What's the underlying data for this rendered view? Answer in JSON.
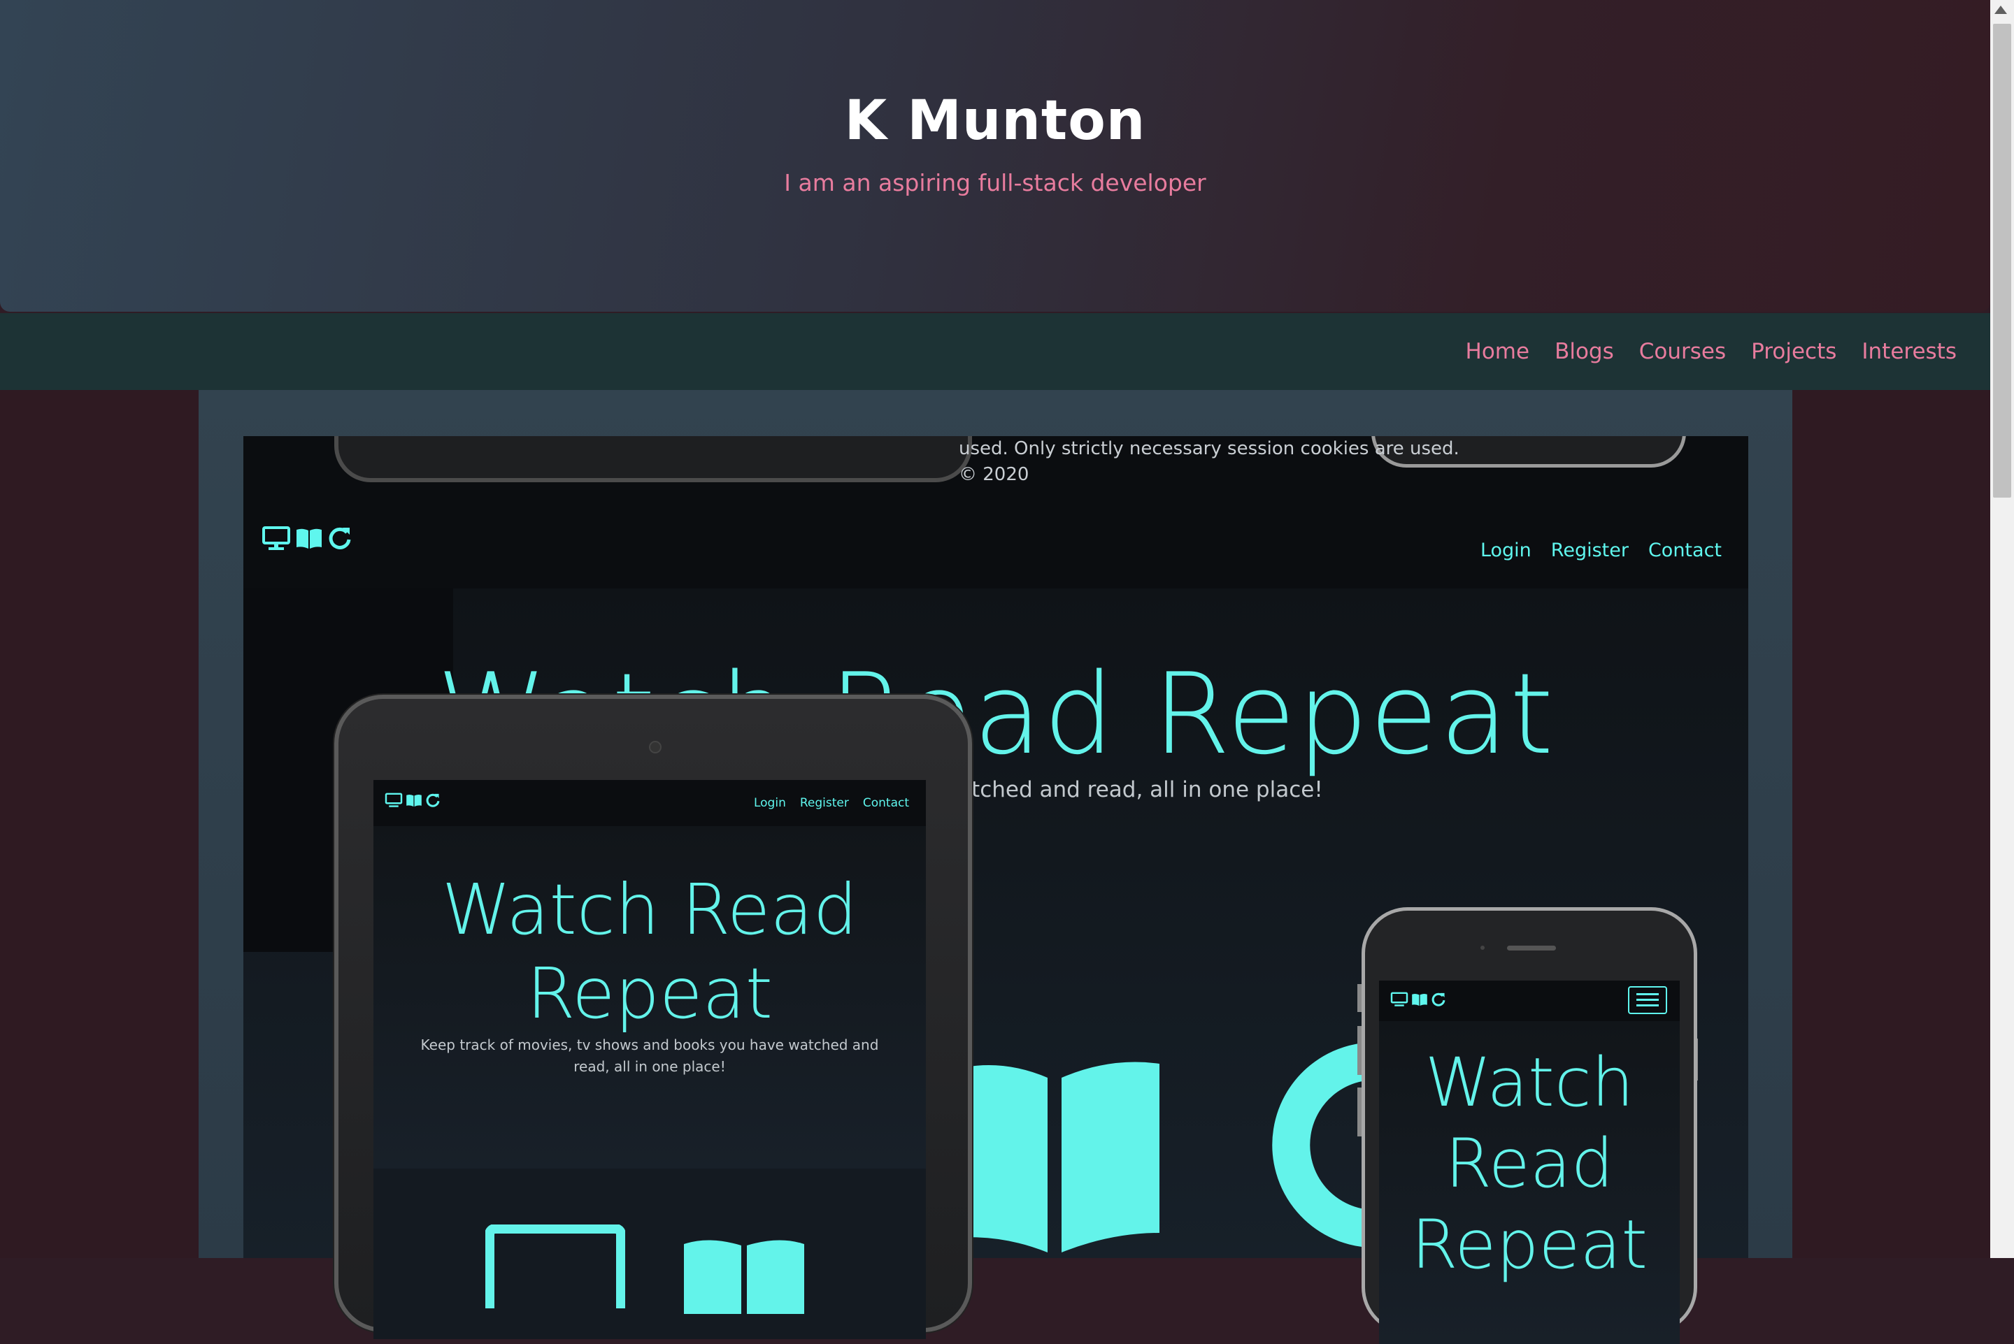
{
  "header": {
    "title": "K Munton",
    "subtitle": "I am an aspiring full-stack developer"
  },
  "nav": {
    "items": [
      {
        "label": "Home"
      },
      {
        "label": "Blogs"
      },
      {
        "label": "Courses"
      },
      {
        "label": "Projects"
      },
      {
        "label": "Interests"
      }
    ]
  },
  "project": {
    "footer_text_line1": "used. Only strictly necessary session cookies are used.",
    "footer_text_line2": "© 2020",
    "app_nav": {
      "logo_icons": [
        "monitor-icon",
        "book-icon",
        "refresh-icon"
      ],
      "links": [
        "Login",
        "Register",
        "Contact"
      ]
    },
    "app_title": "Watch Read Repeat",
    "app_subtitle_partial": "ks you have watched and read, all in one place!",
    "tablet": {
      "title_line1": "Watch Read",
      "title_line2": "Repeat",
      "subtitle": "Keep track of movies, tv shows and books you have watched and read, all in one place!",
      "links": [
        "Login",
        "Register",
        "Contact"
      ]
    },
    "phone": {
      "title_line1": "Watch",
      "title_line2": "Read",
      "title_line3": "Repeat"
    },
    "carousel": {
      "prev_icon": "chevron-left-icon",
      "next_icon": "chevron-right-icon"
    }
  },
  "colors": {
    "accent_pink": "#e87c9e",
    "accent_cyan": "#63f3ea",
    "nav_bg": "#1d3335"
  }
}
